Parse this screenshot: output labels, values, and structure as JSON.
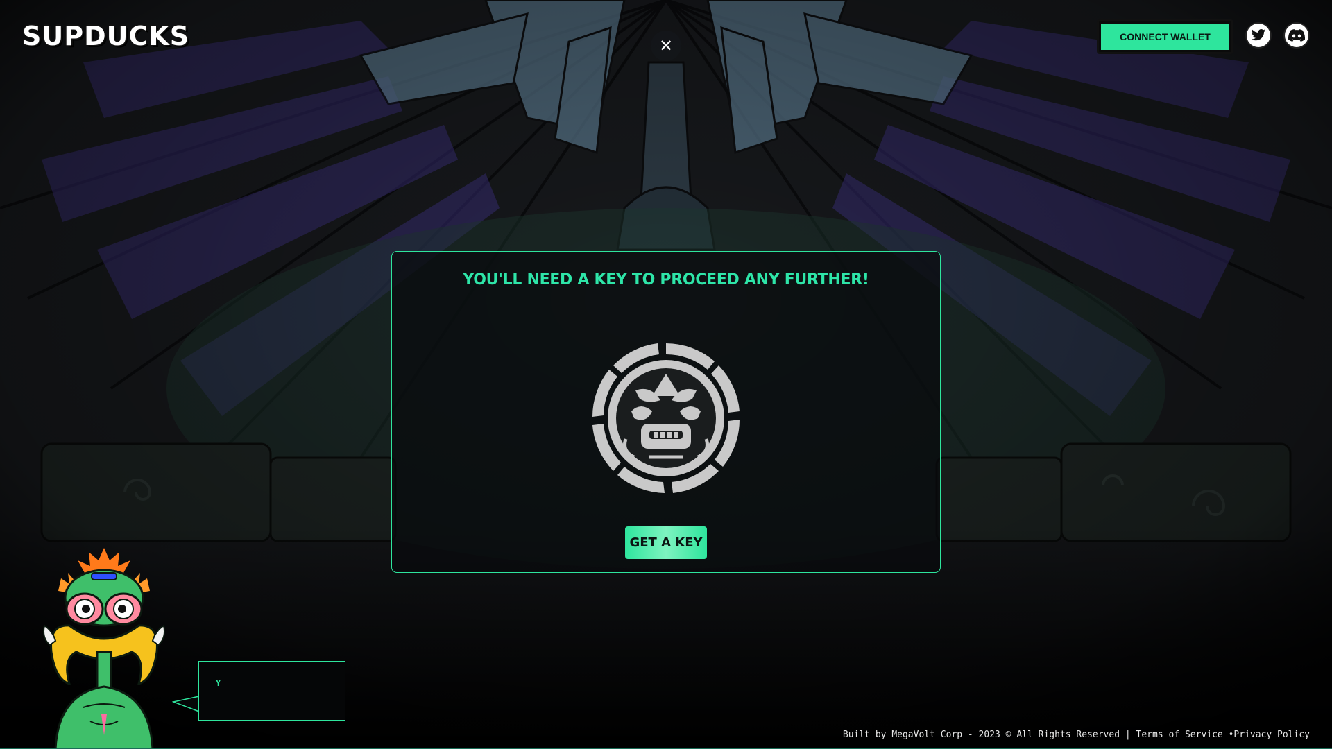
{
  "header": {
    "logo_text": "SUPDUCKS",
    "connect_wallet_label": "CONNECT WALLET",
    "social_icons": [
      "twitter-icon",
      "discord-icon"
    ]
  },
  "close_button": {
    "symbol": "✕"
  },
  "modal": {
    "title": "YOU'LL NEED A KEY TO PROCEED ANY FURTHER!",
    "emblem_icon": "key-emblem-icon",
    "button_label": "GET A KEY"
  },
  "speech_bubble": {
    "text": "Y"
  },
  "footer": {
    "credit": "Built by MegaVolt Corp - 2023 © All Rights Reserved |",
    "terms_label": "Terms of Service",
    "privacy_label": "•Privacy Policy"
  },
  "colors": {
    "accent": "#2ee59d",
    "title": "#2ee5a8",
    "background": "#050607"
  }
}
